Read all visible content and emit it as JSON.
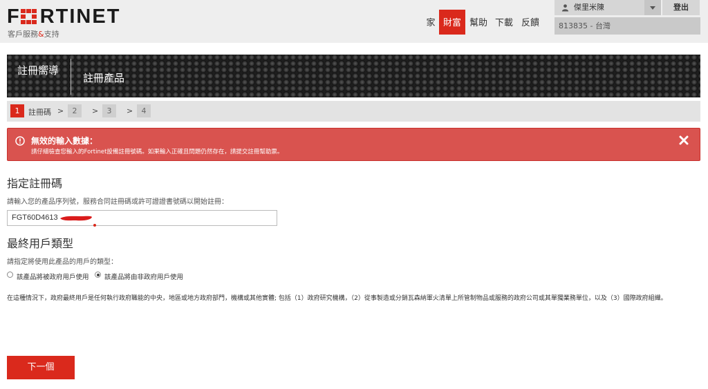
{
  "header": {
    "logo_text": "FRTINET",
    "subtitle_prefix": "客戶服務",
    "subtitle_amp": "&",
    "subtitle_suffix": "支持",
    "nav": [
      {
        "label": "家"
      },
      {
        "label": "財富"
      },
      {
        "label": "幫助"
      },
      {
        "label": "下載"
      },
      {
        "label": "反饋"
      }
    ],
    "user_name": "傑里米陳",
    "logout_label": "登出",
    "account_label": "813835 - 台灣",
    "colors": {
      "brand": "#da291c",
      "header_bg": "#eeeeee"
    }
  },
  "banner": {
    "title1": "註冊嚮導",
    "title2": "註冊產品"
  },
  "steps": [
    {
      "num": "1",
      "label": "註冊碼",
      "active": true
    },
    {
      "num": "2",
      "label": "",
      "active": false
    },
    {
      "num": "3",
      "label": "",
      "active": false
    },
    {
      "num": "4",
      "label": "",
      "active": false
    }
  ],
  "step_separator": ">",
  "alert": {
    "icon": "exclamation-circle-icon",
    "title": "無效的輸入數據：",
    "message": "請仔細檢查您輸入的Fortinet設備註冊號碼。如果輸入正確且問題仍然存在，請提交註冊幫助票。",
    "close_icon": "close-icon",
    "color": "#d9534f"
  },
  "form": {
    "code_heading": "指定註冊碼",
    "code_hint": "請輸入您的產品序列號，服務合同註冊碼或許可證證書號碼以開始註冊：",
    "code_value": "FGT60D4613",
    "user_type_heading": "最終用戶類型",
    "user_type_hint": "請指定將使用此產品的用戶的類型：",
    "options": [
      {
        "label": "該產品將被政府用戶使用",
        "checked": false
      },
      {
        "label": "該產品將由非政府用戶使用",
        "checked": true
      }
    ],
    "note": "在這種情況下，政府最終用戶是任何執行政府職能的中央，地區或地方政府部門，機構或其他實體; 包括（1）政府研究機構，（2）從事製造或分銷瓦森納軍火清單上所管制物品或服務的政府公司或其單獨業務單位，以及（3）國際政府組織。",
    "next_label": "下一個"
  }
}
